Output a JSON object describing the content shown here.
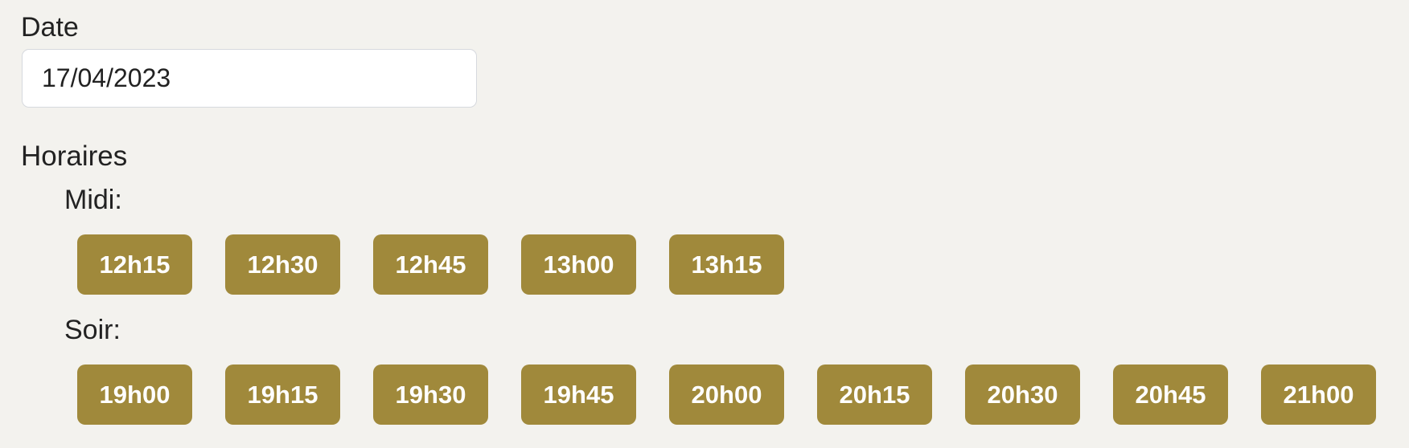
{
  "date": {
    "label": "Date",
    "value": "17/04/2023"
  },
  "horaires": {
    "label": "Horaires",
    "midi": {
      "label": "Midi:",
      "slots": [
        "12h15",
        "12h30",
        "12h45",
        "13h00",
        "13h15"
      ]
    },
    "soir": {
      "label": "Soir:",
      "slots": [
        "19h00",
        "19h15",
        "19h30",
        "19h45",
        "20h00",
        "20h15",
        "20h30",
        "20h45",
        "21h00"
      ]
    }
  },
  "colors": {
    "slot_background": "#a0893b",
    "slot_text": "#ffffff",
    "page_background": "#f3f2ee"
  }
}
